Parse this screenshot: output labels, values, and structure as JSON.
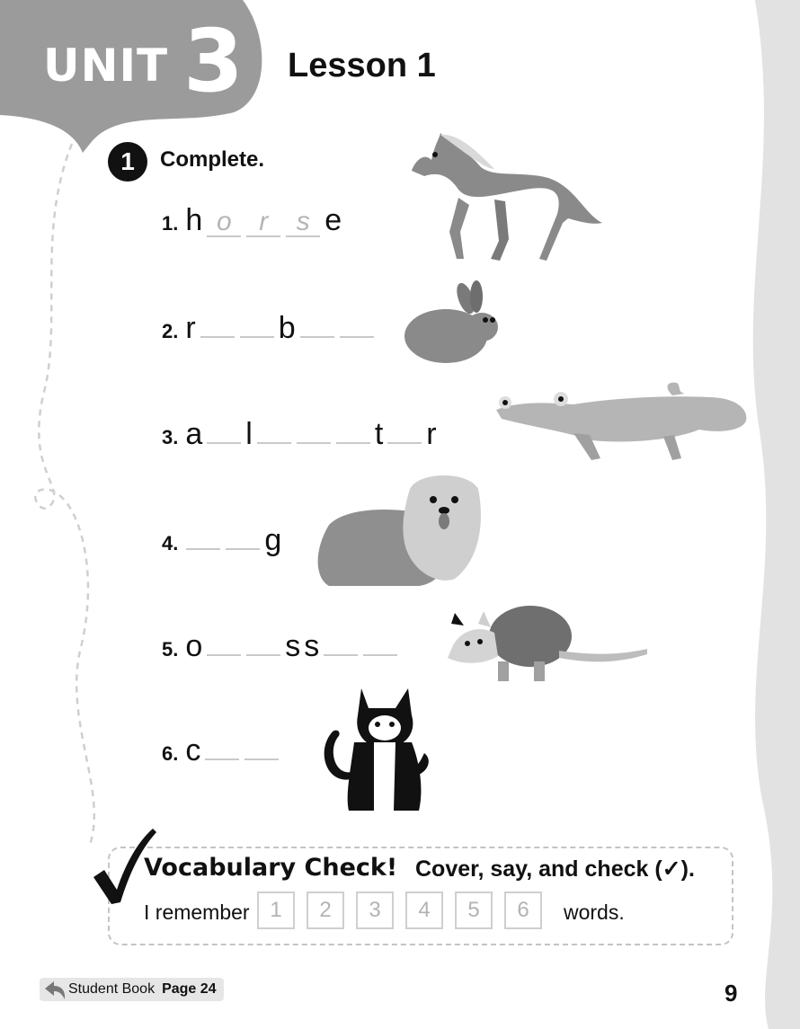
{
  "header": {
    "unit_word": "UNIT",
    "unit_number": "3",
    "lesson": "Lesson 1"
  },
  "exercise": {
    "number": "1",
    "instruction": "Complete."
  },
  "items": [
    {
      "num": "1.",
      "animal": "horse-icon",
      "parts": [
        "h",
        {
          "blank": "o"
        },
        {
          "blank": "r"
        },
        {
          "blank": "s"
        },
        "e"
      ]
    },
    {
      "num": "2.",
      "animal": "rabbit-icon",
      "parts": [
        "r",
        {
          "blank": ""
        },
        {
          "blank": ""
        },
        "b",
        {
          "blank": ""
        },
        {
          "blank": ""
        }
      ]
    },
    {
      "num": "3.",
      "animal": "alligator-icon",
      "parts": [
        "a",
        {
          "blank": ""
        },
        "l",
        {
          "blank": ""
        },
        {
          "blank": ""
        },
        {
          "blank": ""
        },
        "t",
        {
          "blank": ""
        },
        "r"
      ]
    },
    {
      "num": "4.",
      "animal": "dog-icon",
      "parts": [
        {
          "blank": ""
        },
        {
          "blank": ""
        },
        "g"
      ]
    },
    {
      "num": "5.",
      "animal": "opossum-icon",
      "parts": [
        "o",
        {
          "blank": ""
        },
        {
          "blank": ""
        },
        "s",
        "s",
        {
          "blank": ""
        },
        {
          "blank": ""
        }
      ]
    },
    {
      "num": "6.",
      "animal": "cat-icon",
      "parts": [
        "c",
        {
          "blank": ""
        },
        {
          "blank": ""
        }
      ]
    }
  ],
  "vocab_check": {
    "title": "Vocabulary Check!",
    "instruction": "Cover, say, and check (✓).",
    "prefix": "I remember",
    "boxes": [
      "1",
      "2",
      "3",
      "4",
      "5",
      "6"
    ],
    "suffix": "words."
  },
  "footer": {
    "book_label": "Student Book",
    "page_ref": "Page 24",
    "page_number": "9"
  }
}
